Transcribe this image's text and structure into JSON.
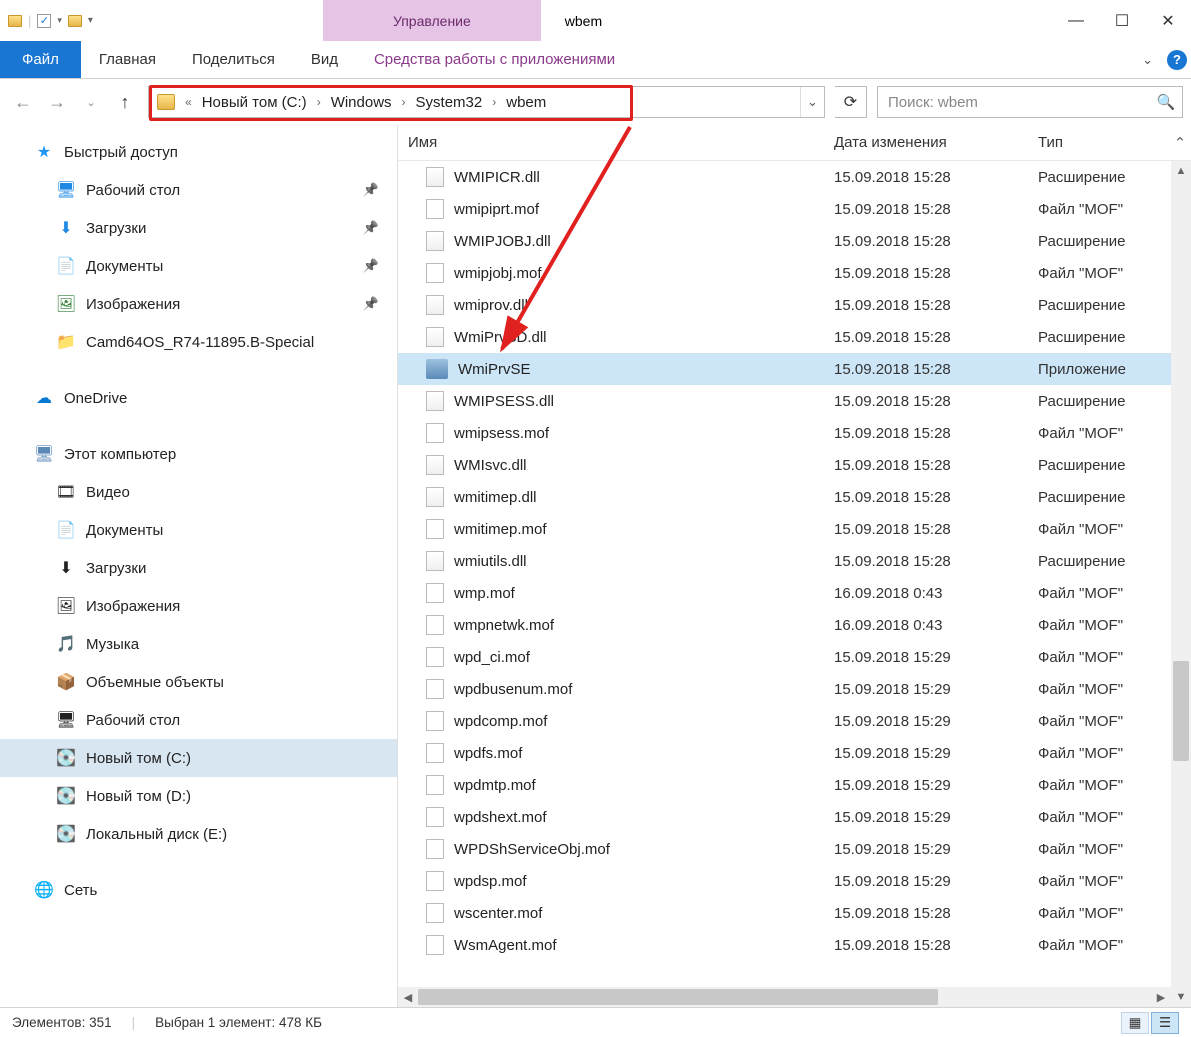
{
  "titlebar": {
    "context_tab": "Управление",
    "folder_title": "wbem"
  },
  "ribbon": {
    "file": "Файл",
    "home": "Главная",
    "share": "Поделиться",
    "view": "Вид",
    "app_tools": "Средства работы с приложениями"
  },
  "breadcrumb": {
    "segments": [
      "Новый том (C:)",
      "Windows",
      "System32",
      "wbem"
    ]
  },
  "search": {
    "placeholder": "Поиск: wbem"
  },
  "sidebar": {
    "quick_access": "Быстрый доступ",
    "quick_items": [
      {
        "label": "Рабочий стол",
        "icon": "🖥",
        "color": "#1e88e5"
      },
      {
        "label": "Загрузки",
        "icon": "⬇",
        "color": "#1e88e5"
      },
      {
        "label": "Документы",
        "icon": "📄",
        "color": "#666"
      },
      {
        "label": "Изображения",
        "icon": "🖼",
        "color": "#2e7d32"
      },
      {
        "label": "Camd64OS_R74-11895.B-Special",
        "icon": "📁",
        "color": "#d4a026"
      }
    ],
    "onedrive": "OneDrive",
    "this_pc": "Этот компьютер",
    "pc_items": [
      {
        "label": "Видео",
        "icon": "🎞"
      },
      {
        "label": "Документы",
        "icon": "📄"
      },
      {
        "label": "Загрузки",
        "icon": "⬇"
      },
      {
        "label": "Изображения",
        "icon": "🖼"
      },
      {
        "label": "Музыка",
        "icon": "🎵"
      },
      {
        "label": "Объемные объекты",
        "icon": "📦"
      },
      {
        "label": "Рабочий стол",
        "icon": "🖥"
      },
      {
        "label": "Новый том (C:)",
        "icon": "💽",
        "selected": true
      },
      {
        "label": "Новый том (D:)",
        "icon": "💽"
      },
      {
        "label": "Локальный диск (E:)",
        "icon": "💽"
      }
    ],
    "network": "Сеть"
  },
  "columns": {
    "name": "Имя",
    "date": "Дата изменения",
    "type": "Тип"
  },
  "files": [
    {
      "name": "WMIPICR.dll",
      "date": "15.09.2018 15:28",
      "type": "Расширение",
      "icon": "dll",
      "cut": true
    },
    {
      "name": "wmipiprt.mof",
      "date": "15.09.2018 15:28",
      "type": "Файл \"MOF\"",
      "icon": "mof"
    },
    {
      "name": "WMIPJOBJ.dll",
      "date": "15.09.2018 15:28",
      "type": "Расширение",
      "icon": "dll"
    },
    {
      "name": "wmipjobj.mof",
      "date": "15.09.2018 15:28",
      "type": "Файл \"MOF\"",
      "icon": "mof"
    },
    {
      "name": "wmiprov.dll",
      "date": "15.09.2018 15:28",
      "type": "Расширение",
      "icon": "dll"
    },
    {
      "name": "WmiPrvSD.dll",
      "date": "15.09.2018 15:28",
      "type": "Расширение",
      "icon": "dll"
    },
    {
      "name": "WmiPrvSE",
      "date": "15.09.2018 15:28",
      "type": "Приложение",
      "icon": "exe",
      "selected": true
    },
    {
      "name": "WMIPSESS.dll",
      "date": "15.09.2018 15:28",
      "type": "Расширение",
      "icon": "dll"
    },
    {
      "name": "wmipsess.mof",
      "date": "15.09.2018 15:28",
      "type": "Файл \"MOF\"",
      "icon": "mof"
    },
    {
      "name": "WMIsvc.dll",
      "date": "15.09.2018 15:28",
      "type": "Расширение",
      "icon": "dll"
    },
    {
      "name": "wmitimep.dll",
      "date": "15.09.2018 15:28",
      "type": "Расширение",
      "icon": "dll"
    },
    {
      "name": "wmitimep.mof",
      "date": "15.09.2018 15:28",
      "type": "Файл \"MOF\"",
      "icon": "mof"
    },
    {
      "name": "wmiutils.dll",
      "date": "15.09.2018 15:28",
      "type": "Расширение",
      "icon": "dll"
    },
    {
      "name": "wmp.mof",
      "date": "16.09.2018 0:43",
      "type": "Файл \"MOF\"",
      "icon": "mof"
    },
    {
      "name": "wmpnetwk.mof",
      "date": "16.09.2018 0:43",
      "type": "Файл \"MOF\"",
      "icon": "mof"
    },
    {
      "name": "wpd_ci.mof",
      "date": "15.09.2018 15:29",
      "type": "Файл \"MOF\"",
      "icon": "mof"
    },
    {
      "name": "wpdbusenum.mof",
      "date": "15.09.2018 15:29",
      "type": "Файл \"MOF\"",
      "icon": "mof"
    },
    {
      "name": "wpdcomp.mof",
      "date": "15.09.2018 15:29",
      "type": "Файл \"MOF\"",
      "icon": "mof"
    },
    {
      "name": "wpdfs.mof",
      "date": "15.09.2018 15:29",
      "type": "Файл \"MOF\"",
      "icon": "mof"
    },
    {
      "name": "wpdmtp.mof",
      "date": "15.09.2018 15:29",
      "type": "Файл \"MOF\"",
      "icon": "mof"
    },
    {
      "name": "wpdshext.mof",
      "date": "15.09.2018 15:29",
      "type": "Файл \"MOF\"",
      "icon": "mof"
    },
    {
      "name": "WPDShServiceObj.mof",
      "date": "15.09.2018 15:29",
      "type": "Файл \"MOF\"",
      "icon": "mof"
    },
    {
      "name": "wpdsp.mof",
      "date": "15.09.2018 15:29",
      "type": "Файл \"MOF\"",
      "icon": "mof"
    },
    {
      "name": "wscenter.mof",
      "date": "15.09.2018 15:28",
      "type": "Файл \"MOF\"",
      "icon": "mof"
    },
    {
      "name": "WsmAgent.mof",
      "date": "15.09.2018 15:28",
      "type": "Файл \"MOF\"",
      "icon": "mof"
    }
  ],
  "status": {
    "items": "Элементов: 351",
    "selected": "Выбран 1 элемент: 478 КБ"
  }
}
